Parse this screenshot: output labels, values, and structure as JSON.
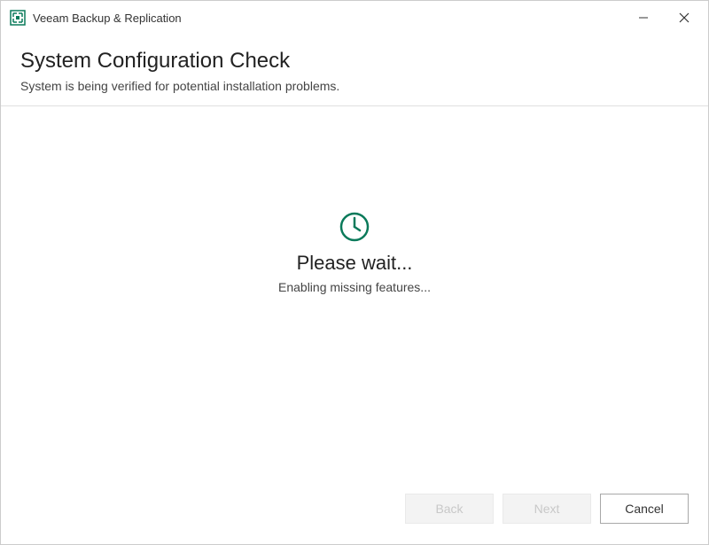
{
  "titlebar": {
    "app_title": "Veeam Backup & Replication"
  },
  "header": {
    "title": "System Configuration Check",
    "subtitle": "System is being verified for potential installation problems."
  },
  "content": {
    "wait_text": "Please wait...",
    "status_text": "Enabling missing features..."
  },
  "footer": {
    "back_label": "Back",
    "next_label": "Next",
    "cancel_label": "Cancel"
  },
  "icons": {
    "clock": "clock-icon",
    "app": "veeam-icon",
    "minimize": "minimize-icon",
    "close": "close-icon"
  },
  "colors": {
    "accent": "#0a7a5a",
    "text": "#222222",
    "muted": "#444444"
  }
}
